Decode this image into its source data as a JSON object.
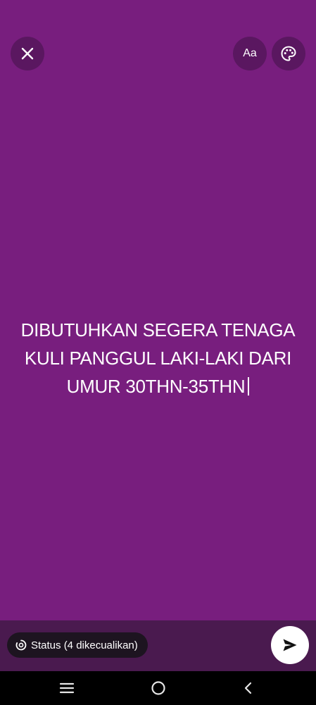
{
  "editor": {
    "background_color": "#781e7e",
    "text_lines": [
      "DIBUTUHKAN SEGERA TENAGA",
      "KULI PANGGUL LAKI-LAKI DARI",
      "UMUR 30THN-35THN"
    ],
    "font_button_label": "Aa",
    "icons": {
      "close": "close-icon",
      "palette": "palette-icon"
    }
  },
  "footer": {
    "audience_label": "Status (4 dikecualikan)",
    "audience_icon": "status-icon",
    "send_icon": "send-icon"
  },
  "navigation": {
    "icons": [
      "menu-icon",
      "home-icon",
      "back-icon"
    ]
  }
}
